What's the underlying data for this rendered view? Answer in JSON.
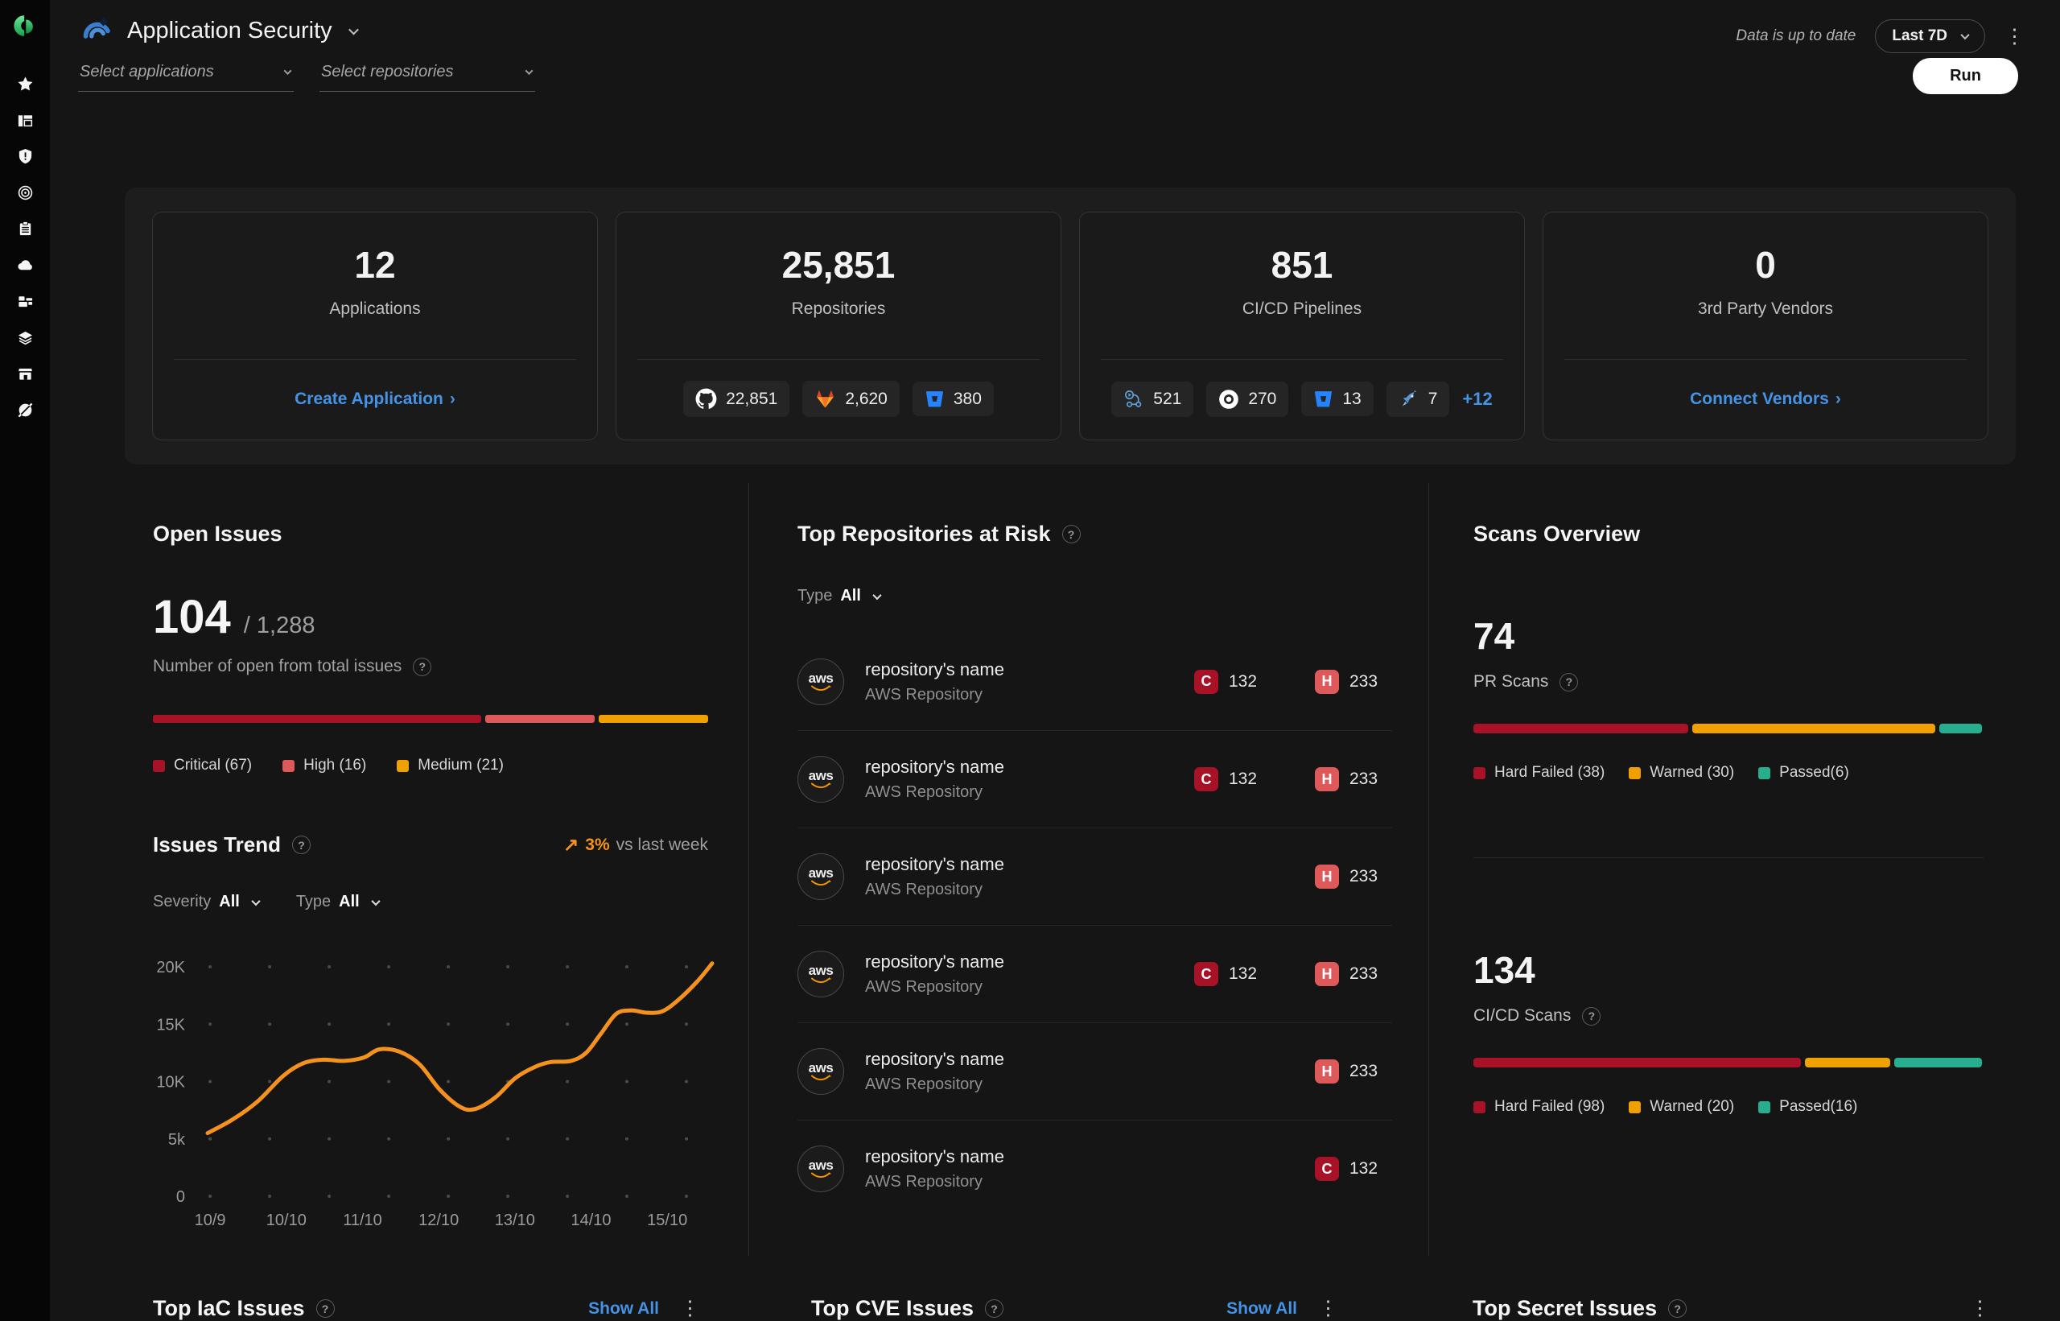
{
  "colors": {
    "critical": "#a81226",
    "high": "#de5a5a",
    "medium": "#f0a000",
    "warned": "#f0a000",
    "passed": "#27ae8f",
    "link_blue": "#4493e5",
    "trend_orange": "#f5921e"
  },
  "sidebar": {
    "icons": [
      "cycode-logo",
      "star",
      "dashboard-layout",
      "shield-alert",
      "scan-target",
      "report-clipboard",
      "cloud",
      "blocks",
      "layers",
      "storefront",
      "compass"
    ]
  },
  "header": {
    "title": "Application Security",
    "status": "Data is up to date",
    "range": "Last 7D"
  },
  "filters": {
    "applications_placeholder": "Select applications",
    "repositories_placeholder": "Select repositories",
    "run_label": "Run"
  },
  "summary_cards": {
    "applications": {
      "value": "12",
      "label": "Applications",
      "link": "Create Application",
      "link_arrow": "›"
    },
    "repositories": {
      "value": "25,851",
      "label": "Repositories",
      "chips": [
        {
          "icon": "github-icon",
          "count": "22,851"
        },
        {
          "icon": "gitlab-icon",
          "count": "2,620"
        },
        {
          "icon": "bitbucket-icon",
          "count": "380"
        }
      ]
    },
    "pipelines": {
      "value": "851",
      "label": "CI/CD Pipelines",
      "chips": [
        {
          "icon": "github-actions-icon",
          "count": "521"
        },
        {
          "icon": "circleci-icon",
          "count": "270"
        },
        {
          "icon": "bitbucket-pipelines-icon",
          "count": "13"
        },
        {
          "icon": "azure-pipelines-icon",
          "count": "7"
        }
      ],
      "more_link": "+12"
    },
    "vendors": {
      "value": "0",
      "label": "3rd Party Vendors",
      "link": "Connect Vendors",
      "link_arrow": "›"
    }
  },
  "open_issues": {
    "title": "Open Issues",
    "open_count": "104",
    "total_count": "/ 1,288",
    "caption": "Number of open from total issues",
    "segments": [
      {
        "label": "Critical (67)",
        "color": "#a81226",
        "width": "60%"
      },
      {
        "label": "High (16)",
        "color": "#de5a5a",
        "width": "20%"
      },
      {
        "label": "Medium (21)",
        "color": "#f0a000",
        "width": "20%"
      }
    ],
    "chart_data": {
      "type": "stacked-bar",
      "categories": [
        "Critical",
        "High",
        "Medium"
      ],
      "values": [
        67,
        16,
        21
      ],
      "open_total": 104,
      "all_total": 1288
    }
  },
  "issues_trend": {
    "title": "Issues Trend",
    "delta_arrow": "↗",
    "delta": "3%",
    "delta_suffix": "vs last week",
    "severity_label": "Severity",
    "severity_value": "All",
    "type_label": "Type",
    "type_value": "All",
    "chart_data": {
      "type": "line",
      "color": "#f5921e",
      "x_ticks": [
        "10/9",
        "10/10",
        "11/10",
        "12/10",
        "13/10",
        "14/10",
        "15/10"
      ],
      "y_ticks": [
        {
          "label": "20K",
          "value": 20000
        },
        {
          "label": "15K",
          "value": 15000
        },
        {
          "label": "10K",
          "value": 10000
        },
        {
          "label": "5k",
          "value": 5000
        },
        {
          "label": "0",
          "value": 0
        }
      ],
      "ylim": [
        0,
        21000
      ],
      "grid_values": [
        0,
        5000,
        10000,
        15000,
        20000
      ],
      "tick_start": 0.005,
      "tick_step": 0.151,
      "dot_cols": 9,
      "dot_step": 0.118,
      "points": [
        [
          0.0,
          5500
        ],
        [
          0.05,
          6700
        ],
        [
          0.1,
          8300
        ],
        [
          0.15,
          10500
        ],
        [
          0.19,
          11600
        ],
        [
          0.23,
          11900
        ],
        [
          0.27,
          11800
        ],
        [
          0.31,
          12100
        ],
        [
          0.34,
          12800
        ],
        [
          0.38,
          12600
        ],
        [
          0.42,
          11500
        ],
        [
          0.46,
          9300
        ],
        [
          0.5,
          7800
        ],
        [
          0.53,
          7600
        ],
        [
          0.57,
          8600
        ],
        [
          0.61,
          10300
        ],
        [
          0.65,
          11300
        ],
        [
          0.68,
          11700
        ],
        [
          0.72,
          11800
        ],
        [
          0.75,
          12500
        ],
        [
          0.78,
          14200
        ],
        [
          0.81,
          15900
        ],
        [
          0.84,
          16200
        ],
        [
          0.87,
          16000
        ],
        [
          0.9,
          16100
        ],
        [
          0.93,
          17000
        ],
        [
          0.97,
          18700
        ],
        [
          1.0,
          20300
        ]
      ]
    }
  },
  "top_repos": {
    "title": "Top Repositories at Risk",
    "type_label": "Type",
    "type_value": "All",
    "critical_letter": "C",
    "high_letter": "H",
    "rows": [
      {
        "name": "repository's name",
        "subtitle": "AWS Repository",
        "critical": "132",
        "high": "233"
      },
      {
        "name": "repository's name",
        "subtitle": "AWS Repository",
        "critical": "132",
        "high": "233"
      },
      {
        "name": "repository's name",
        "subtitle": "AWS Repository",
        "critical": null,
        "high": "233"
      },
      {
        "name": "repository's name",
        "subtitle": "AWS Repository",
        "critical": "132",
        "high": "233"
      },
      {
        "name": "repository's name",
        "subtitle": "AWS Repository",
        "critical": null,
        "high": "233"
      },
      {
        "name": "repository's name",
        "subtitle": "AWS Repository",
        "critical": "132",
        "high": null
      }
    ]
  },
  "scans_overview": {
    "title": "Scans Overview",
    "pr": {
      "value": "74",
      "label": "PR Scans",
      "segments": [
        {
          "label": "Hard Failed (38)",
          "color": "#a81226",
          "width": "43%"
        },
        {
          "label": "Warned (30)",
          "color": "#f0a000",
          "width": "48.5%"
        },
        {
          "label": "Passed(6)",
          "color": "#27ae8f",
          "width": "8.5%"
        }
      ],
      "chart_data": {
        "type": "stacked-bar",
        "categories": [
          "Hard Failed",
          "Warned",
          "Passed"
        ],
        "values": [
          38,
          30,
          6
        ],
        "total": 74
      }
    },
    "cicd": {
      "value": "134",
      "label": "CI/CD Scans",
      "segments": [
        {
          "label": "Hard Failed (98)",
          "color": "#a81226",
          "width": "65.5%"
        },
        {
          "label": "Warned (20)",
          "color": "#f0a000",
          "width": "17%"
        },
        {
          "label": "Passed(16)",
          "color": "#27ae8f",
          "width": "17.5%"
        }
      ],
      "chart_data": {
        "type": "stacked-bar",
        "categories": [
          "Hard Failed",
          "Warned",
          "Passed"
        ],
        "values": [
          98,
          20,
          16
        ],
        "total": 134
      }
    }
  },
  "bottom_sections": {
    "iac": {
      "title": "Top IaC Issues",
      "show_all": "Show All"
    },
    "cve": {
      "title": "Top CVE Issues",
      "show_all": "Show All"
    },
    "secret": {
      "title": "Top Secret Issues"
    }
  }
}
